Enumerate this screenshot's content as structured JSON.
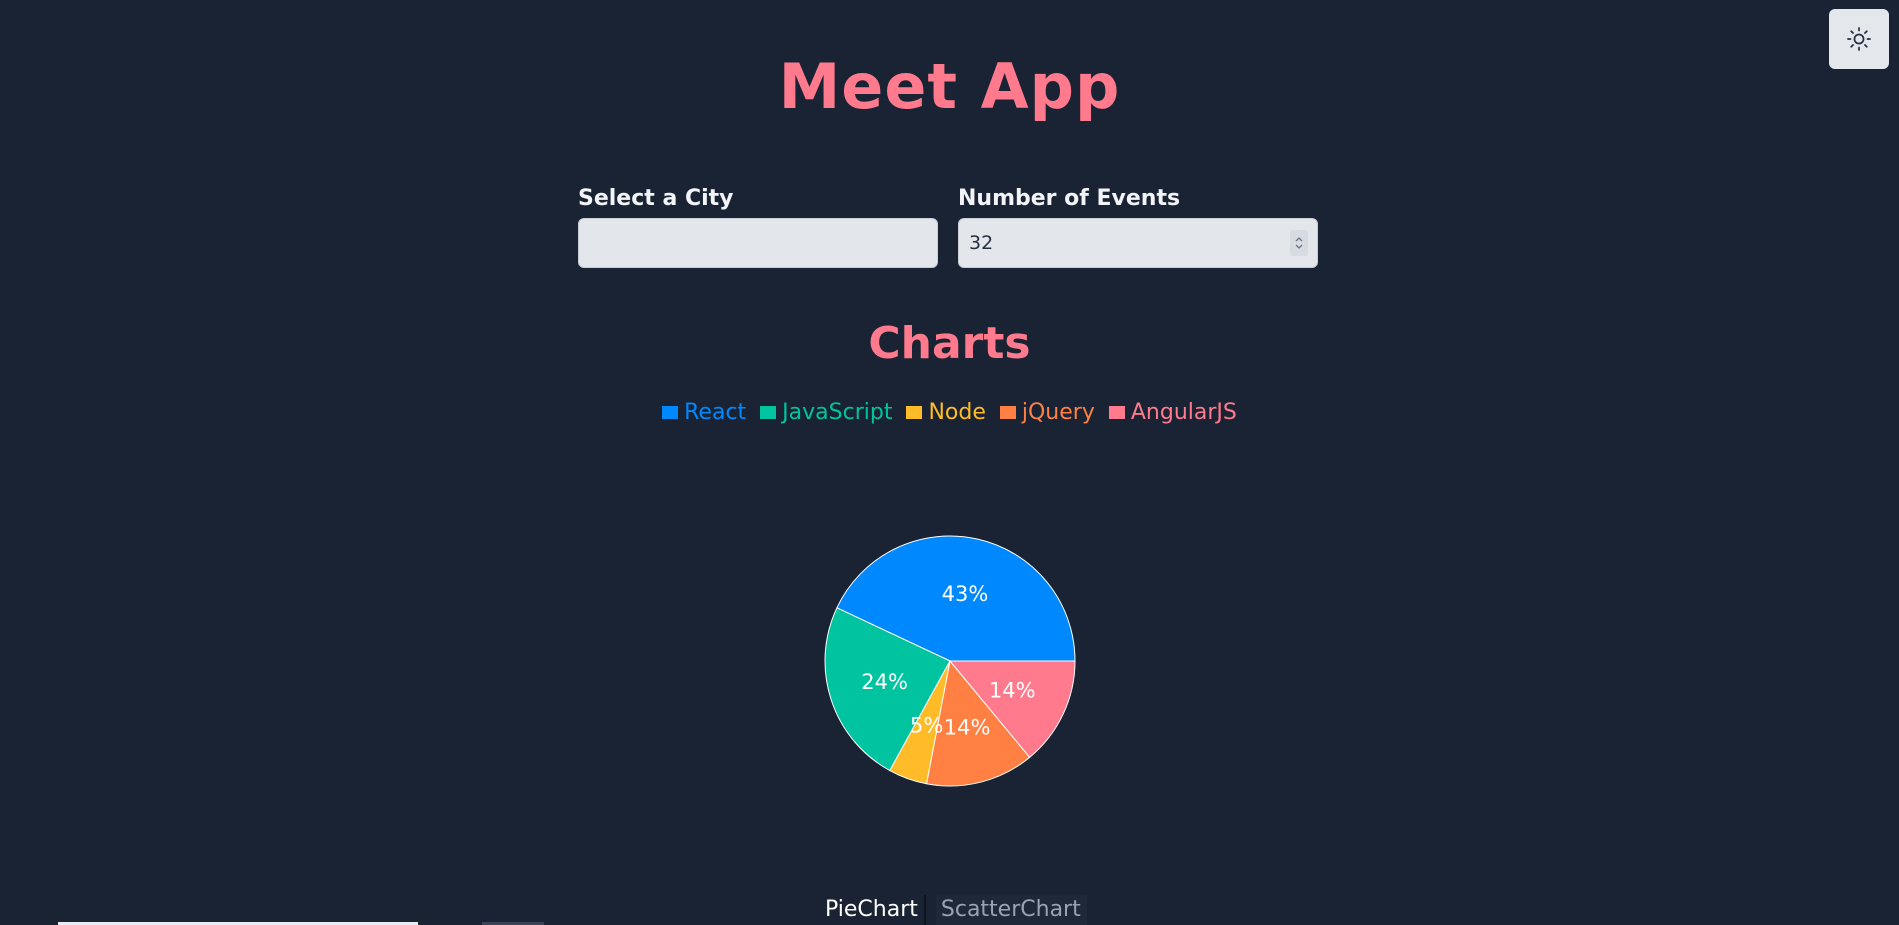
{
  "app": {
    "title": "Meet App",
    "theme_toggle_icon": "sun-icon"
  },
  "filters": {
    "city_label": "Select a City",
    "city_value": "",
    "events_label": "Number of Events",
    "events_value": "32"
  },
  "charts": {
    "heading": "Charts",
    "tabs": [
      {
        "label": "PieChart",
        "active": true
      },
      {
        "label": "ScatterChart",
        "active": false
      }
    ]
  },
  "colors": {
    "background": "#1a2333",
    "accent": "#ff7a8c"
  },
  "chart_data": {
    "type": "pie",
    "categories": [
      "React",
      "JavaScript",
      "Node",
      "jQuery",
      "AngularJS"
    ],
    "values": [
      43,
      24,
      5,
      14,
      14
    ],
    "labels": [
      "43%",
      "24%",
      "5%",
      "14%",
      "14%"
    ],
    "colors": [
      "#0088fe",
      "#00c49f",
      "#ffbb28",
      "#ff8042",
      "#ff7a8c"
    ],
    "legend": "top"
  }
}
